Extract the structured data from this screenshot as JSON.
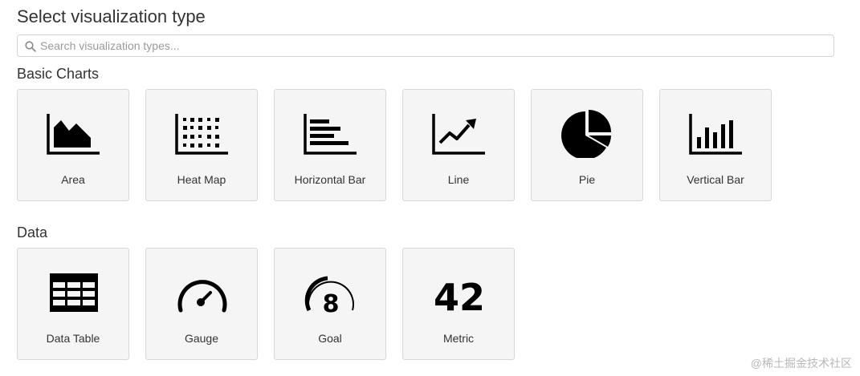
{
  "title": "Select visualization type",
  "search": {
    "placeholder": "Search visualization types..."
  },
  "sections": [
    {
      "title": "Basic Charts",
      "items": [
        {
          "label": "Area",
          "icon": "area-chart-icon"
        },
        {
          "label": "Heat Map",
          "icon": "heat-map-icon"
        },
        {
          "label": "Horizontal Bar",
          "icon": "horizontal-bar-icon"
        },
        {
          "label": "Line",
          "icon": "line-chart-icon"
        },
        {
          "label": "Pie",
          "icon": "pie-chart-icon"
        },
        {
          "label": "Vertical Bar",
          "icon": "vertical-bar-icon"
        }
      ]
    },
    {
      "title": "Data",
      "items": [
        {
          "label": "Data Table",
          "icon": "data-table-icon"
        },
        {
          "label": "Gauge",
          "icon": "gauge-icon"
        },
        {
          "label": "Goal",
          "icon": "goal-icon",
          "value": "8"
        },
        {
          "label": "Metric",
          "icon": "metric-icon",
          "value": "42"
        }
      ]
    }
  ],
  "watermark": "@稀土掘金技术社区"
}
